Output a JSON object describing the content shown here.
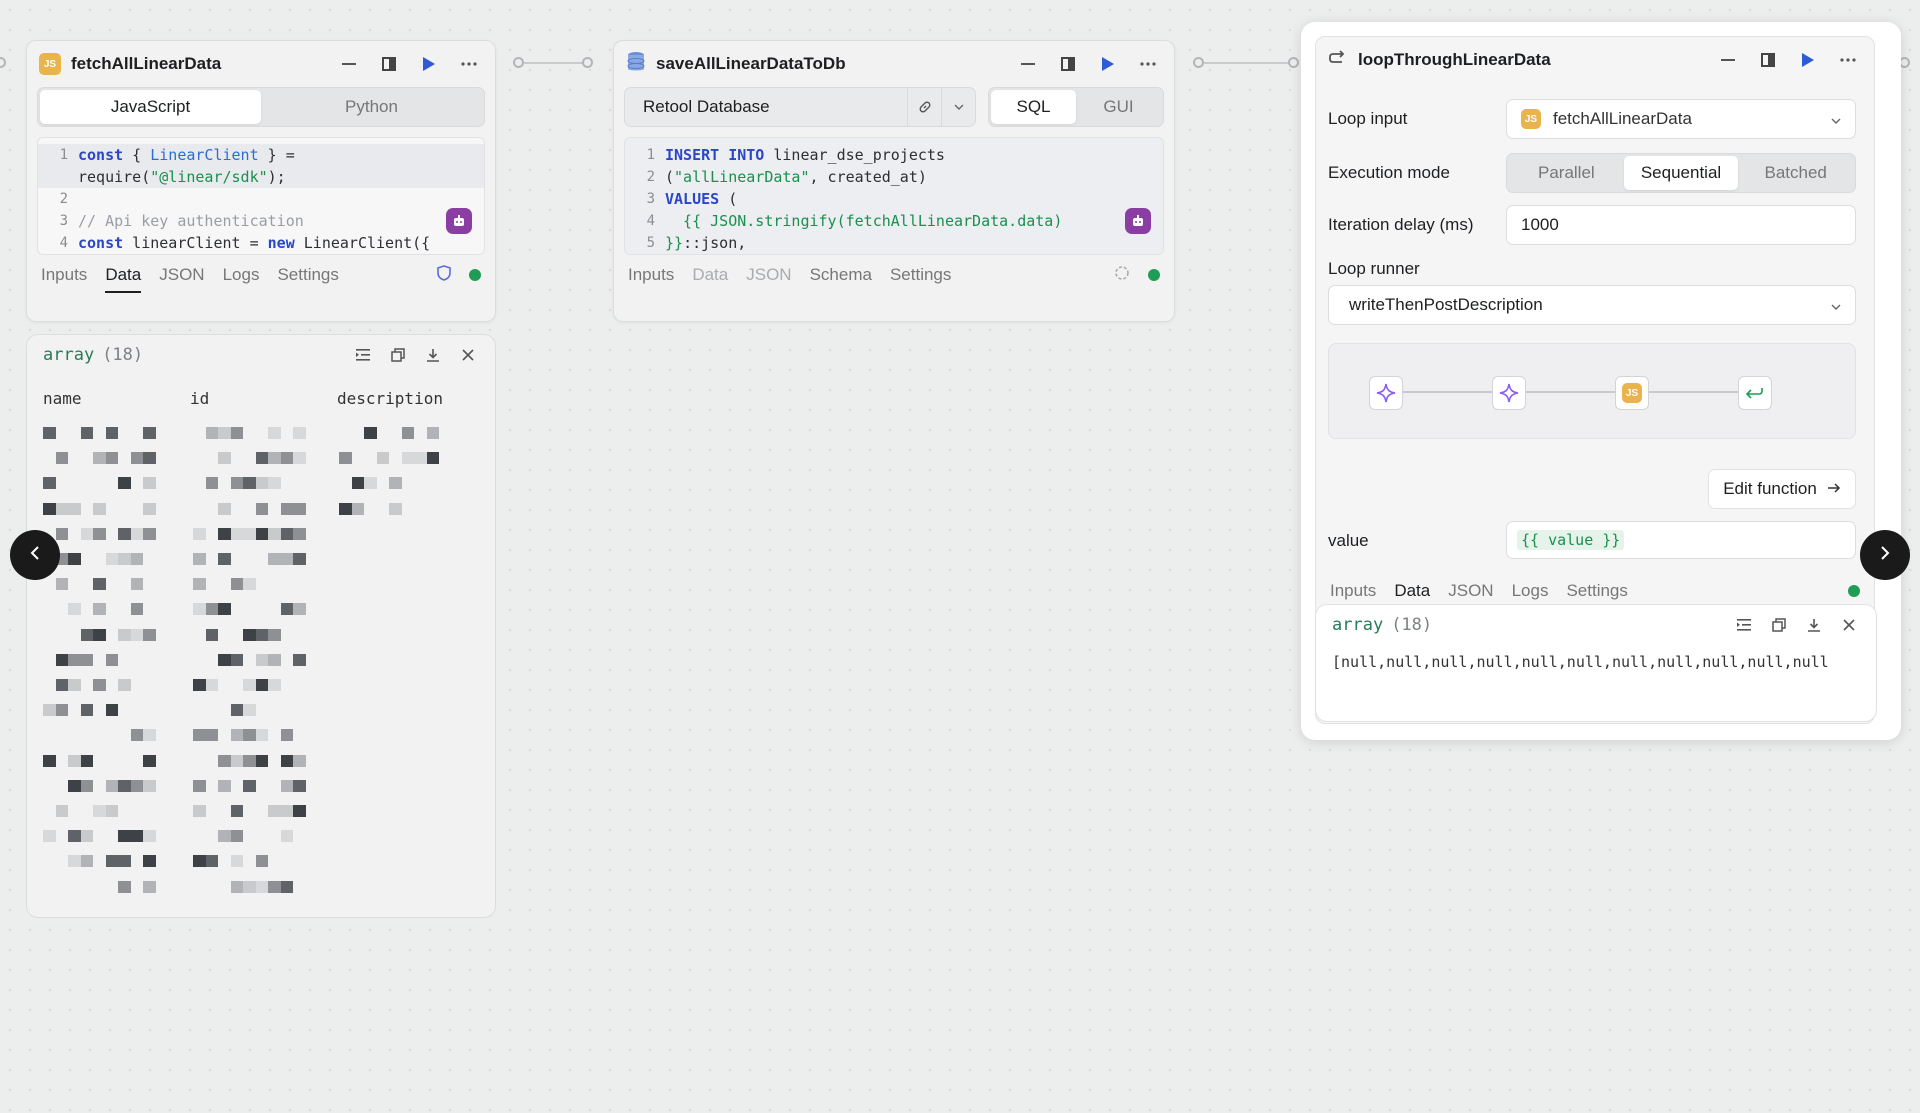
{
  "blocks": {
    "fetch": {
      "title": "fetchAllLinearData",
      "icon": "js-badge-icon",
      "lang_tabs": [
        "JavaScript",
        "Python"
      ],
      "code": [
        {
          "ln": "1",
          "text": "const { LinearClient } =",
          "hl": true
        },
        {
          "ln": "",
          "text": "require(\"@linear/sdk\");",
          "hl": true
        },
        {
          "ln": "2",
          "text": "",
          "hl": false
        },
        {
          "ln": "3",
          "text": "// Api key authentication",
          "hl": false
        },
        {
          "ln": "4",
          "text": "const linearClient = new LinearClient({",
          "hl": false
        }
      ],
      "tabs": [
        "Inputs",
        "Data",
        "JSON",
        "Logs",
        "Settings"
      ],
      "active_tab": "Data",
      "result": {
        "type_label": "array",
        "count": "(18)",
        "columns": [
          "name",
          "id",
          "description"
        ]
      }
    },
    "save": {
      "title": "saveAllLinearDataToDb",
      "resource": "Retool Database",
      "mode_tabs": [
        "SQL",
        "GUI"
      ],
      "code": [
        {
          "ln": "1",
          "text": "INSERT INTO linear_dse_projects"
        },
        {
          "ln": "2",
          "text": "(\"allLinearData\", created_at)"
        },
        {
          "ln": "3",
          "text": "VALUES ("
        },
        {
          "ln": "4",
          "text": "  {{ JSON.stringify(fetchAllLinearData.data)"
        },
        {
          "ln": "5",
          "text": "}}::json,"
        }
      ],
      "tabs": [
        "Inputs",
        "Data",
        "JSON",
        "Schema",
        "Settings"
      ]
    },
    "loop": {
      "title": "loopThroughLinearData",
      "loop_input_label": "Loop input",
      "loop_input_value": "fetchAllLinearData",
      "execution_mode_label": "Execution mode",
      "execution_modes": [
        "Parallel",
        "Sequential",
        "Batched"
      ],
      "active_mode": "Sequential",
      "iteration_delay_label": "Iteration delay (ms)",
      "iteration_delay_value": "1000",
      "loop_runner_label": "Loop runner",
      "loop_runner_value": "writeThenPostDescription",
      "edit_function_label": "Edit function",
      "value_label": "value",
      "value_value": "{{ value }}",
      "tabs": [
        "Inputs",
        "Data",
        "JSON",
        "Logs",
        "Settings"
      ],
      "active_tab": "Data",
      "result": {
        "type_label": "array",
        "count": "(18)",
        "content": "[null,null,null,null,null,null,null,null,null,null,null"
      }
    }
  },
  "colors": {
    "run": "#2d5bd7",
    "ok": "#1f9d55",
    "ai": "#8a3ea3",
    "js": "#e9b44c"
  }
}
